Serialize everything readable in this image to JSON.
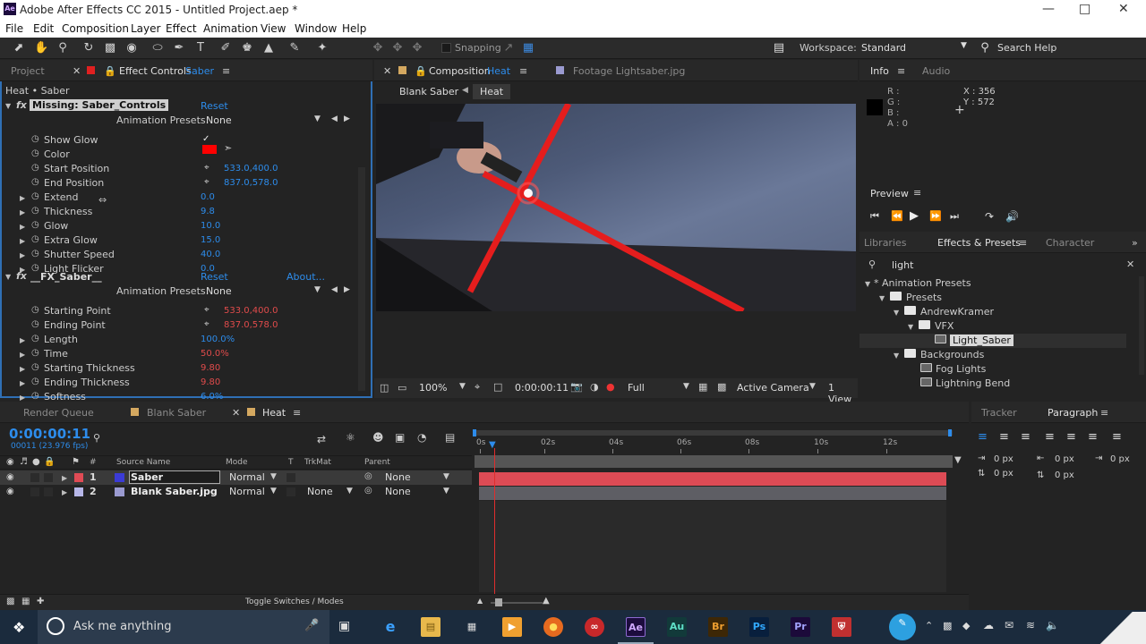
{
  "window": {
    "title": "Adobe After Effects CC 2015 - Untitled Project.aep *",
    "icon": "Ae"
  },
  "menu": [
    "File",
    "Edit",
    "Composition",
    "Layer",
    "Effect",
    "Animation",
    "View",
    "Window",
    "Help"
  ],
  "toolbar": {
    "snapping": "Snapping",
    "workspace_label": "Workspace:",
    "workspace_value": "Standard",
    "search_help": "Search Help"
  },
  "left_panel": {
    "tab_project": "Project",
    "tab_effect_controls": "Effect Controls",
    "tab_effect_controls_target": "Saber",
    "breadcrumb": "Heat • Saber",
    "effect1": {
      "name": "Missing: Saber_Controls",
      "reset": "Reset",
      "anim_presets_label": "Animation Presets:",
      "anim_presets_value": "None",
      "props": [
        {
          "label": "Show Glow",
          "value": "✓"
        },
        {
          "label": "Color",
          "value": ""
        },
        {
          "label": "Start Position",
          "value": "533.0,400.0"
        },
        {
          "label": "End Position",
          "value": "837.0,578.0"
        },
        {
          "label": "Extend",
          "value": "0.0"
        },
        {
          "label": "Thickness",
          "value": "9.8"
        },
        {
          "label": "Glow",
          "value": "10.0"
        },
        {
          "label": "Extra Glow",
          "value": "15.0"
        },
        {
          "label": "Shutter Speed",
          "value": "40.0"
        },
        {
          "label": "Light Flicker",
          "value": "0.0"
        }
      ]
    },
    "effect2": {
      "name": "__FX_Saber__",
      "reset": "Reset",
      "about": "About...",
      "anim_presets_label": "Animation Presets:",
      "anim_presets_value": "None",
      "props": [
        {
          "label": "Starting Point",
          "value": "533.0,400.0"
        },
        {
          "label": "Ending Point",
          "value": "837.0,578.0"
        },
        {
          "label": "Length",
          "value": "100.0%"
        },
        {
          "label": "Time",
          "value": "50.0%"
        },
        {
          "label": "Starting Thickness",
          "value": "9.80"
        },
        {
          "label": "Ending Thickness",
          "value": "9.80"
        },
        {
          "label": "Softness",
          "value": "6.0%"
        }
      ]
    }
  },
  "comp_panel": {
    "tab_comp_label": "Composition",
    "tab_comp_name": "Heat",
    "tab_footage": "Footage Lightsaber.jpg",
    "crumb1": "Blank Saber",
    "crumb2": "Heat",
    "zoom": "100%",
    "timecode": "0:00:00:11",
    "resolution": "Full",
    "camera": "Active Camera",
    "view": "1 View"
  },
  "info_panel": {
    "tab_info": "Info",
    "tab_audio": "Audio",
    "r": "R :",
    "g": "G :",
    "b": "B :",
    "a": "A : 0",
    "x": "X : 356",
    "y": "Y : 572"
  },
  "preview_panel": {
    "title": "Preview"
  },
  "effects_panel": {
    "tab_libraries": "Libraries",
    "tab_effects": "Effects & Presets",
    "tab_character": "Character",
    "search_value": "light",
    "tree": [
      {
        "label": "* Animation Presets",
        "level": 0
      },
      {
        "label": "Presets",
        "level": 1
      },
      {
        "label": "AndrewKramer",
        "level": 2
      },
      {
        "label": "VFX",
        "level": 3
      },
      {
        "label": "Light_Saber",
        "level": 4
      },
      {
        "label": "Backgrounds",
        "level": 2
      },
      {
        "label": "Fog Lights",
        "level": 3
      },
      {
        "label": "Lightning Bend",
        "level": 3
      }
    ]
  },
  "timeline": {
    "tab_render": "Render Queue",
    "tab_blank": "Blank Saber",
    "tab_heat": "Heat",
    "timecode": "0:00:00:11",
    "fps": "00011 (23.976 fps)",
    "col_num": "#",
    "col_source": "Source Name",
    "col_mode": "Mode",
    "col_t": "T",
    "col_trkmat": "TrkMat",
    "col_parent": "Parent",
    "layers": [
      {
        "num": "1",
        "name": "Saber",
        "mode": "Normal",
        "trkmat": "",
        "parent": "None",
        "color": "#3b3bd6"
      },
      {
        "num": "2",
        "name": "Blank Saber.jpg",
        "mode": "Normal",
        "trkmat": "None",
        "parent": "None",
        "color": "#9a9ad0"
      }
    ],
    "ruler": [
      "0s",
      "02s",
      "04s",
      "06s",
      "08s",
      "10s",
      "12s"
    ],
    "toggle": "Toggle Switches / Modes"
  },
  "tracker_panel": {
    "tab_tracker": "Tracker",
    "tab_paragraph": "Paragraph",
    "px1": "0 px",
    "px2": "0 px",
    "px3": "0 px",
    "px4": "0 px",
    "px5": "0 px"
  },
  "taskbar": {
    "search": "Ask me anything",
    "apps": [
      "Ae",
      "Au",
      "Br",
      "Ps",
      "Pr"
    ]
  }
}
